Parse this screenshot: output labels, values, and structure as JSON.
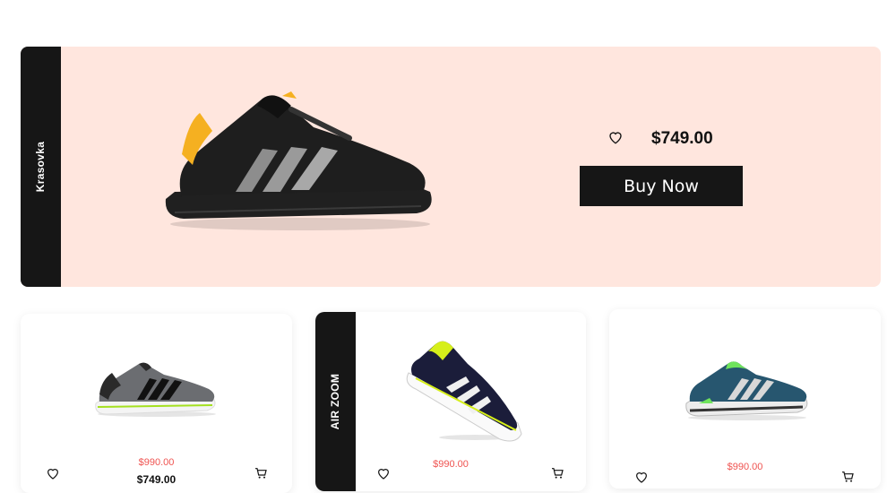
{
  "hero": {
    "side_label": "Krasovka",
    "price": "$749.00",
    "buy_label": "Buy Now",
    "icons": {
      "favorite": "heart-outline-icon"
    }
  },
  "cards": [
    {
      "price": "$990.00",
      "sub_price": "$749.00",
      "icons": [
        "heart-outline-icon",
        "cart-icon"
      ]
    },
    {
      "side_label": "AIR ZOOM",
      "price": "$990.00",
      "icons": [
        "heart-outline-icon",
        "cart-icon"
      ]
    },
    {
      "price": "$990.00",
      "icons": [
        "heart-outline-icon",
        "cart-icon"
      ]
    }
  ],
  "colors": {
    "hero_bg": "#ffe6de",
    "dark": "#161616",
    "price_accent": "#ef5350"
  }
}
